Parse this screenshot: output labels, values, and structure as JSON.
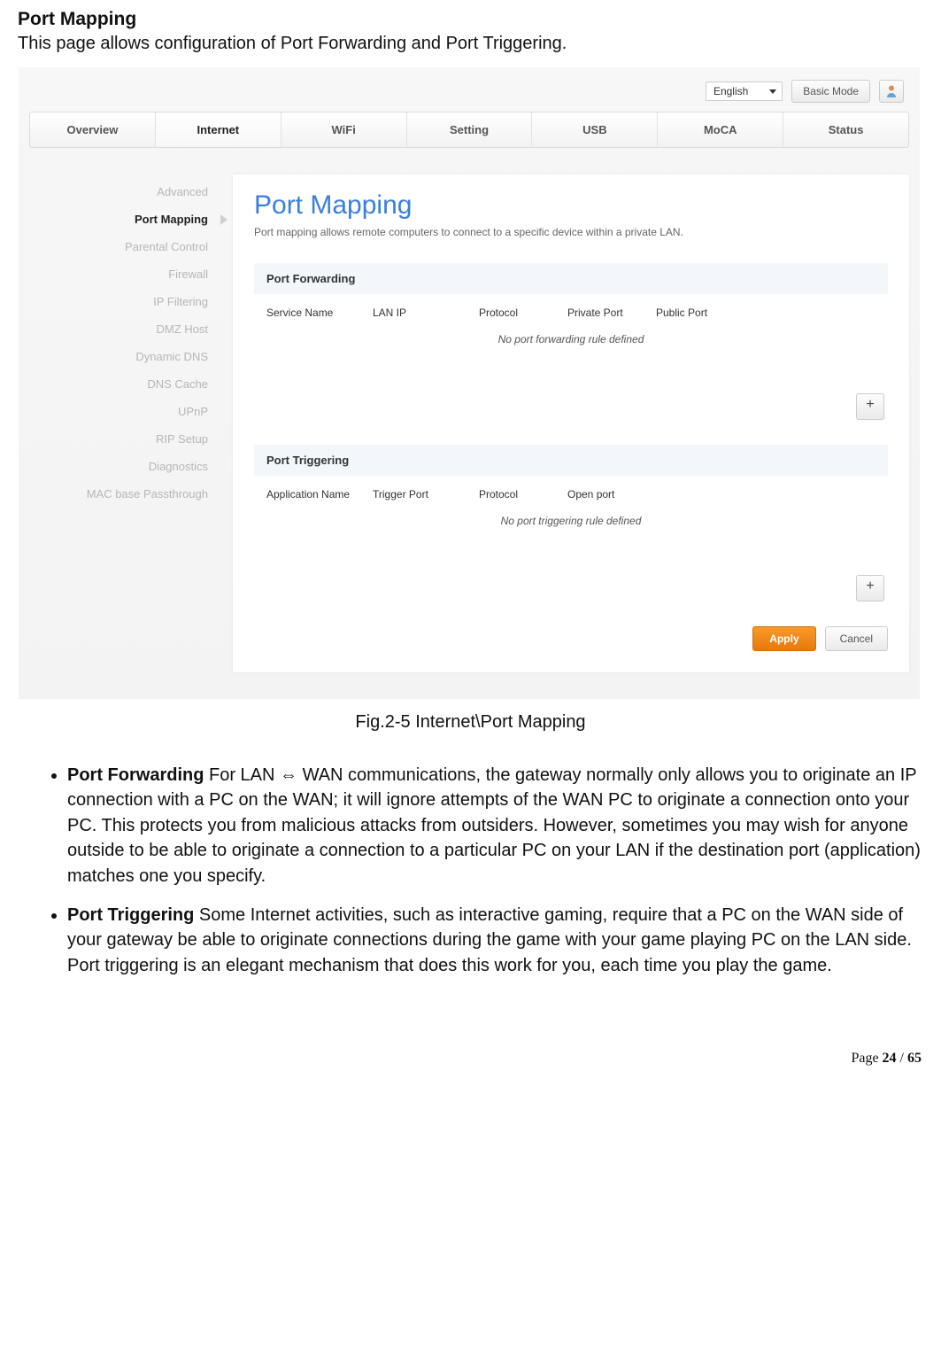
{
  "doc": {
    "title": "Port Mapping",
    "subtitle": "This page allows configuration of Port Forwarding and Port Triggering."
  },
  "topbar": {
    "language": "English",
    "basic_mode": "Basic Mode"
  },
  "nav": {
    "items": [
      "Overview",
      "Internet",
      "WiFi",
      "Setting",
      "USB",
      "MoCA",
      "Status"
    ],
    "active_index": 1
  },
  "sidebar": {
    "items": [
      "Advanced",
      "Port Mapping",
      "Parental Control",
      "Firewall",
      "IP Filtering",
      "DMZ Host",
      "Dynamic DNS",
      "DNS Cache",
      "UPnP",
      "RIP Setup",
      "Diagnostics",
      "MAC base Passthrough"
    ],
    "active_index": 1
  },
  "main": {
    "heading": "Port Mapping",
    "description": "Port mapping allows remote computers to connect to a specific device within a private LAN.",
    "port_forwarding": {
      "title": "Port Forwarding",
      "columns": [
        "Service Name",
        "LAN IP",
        "Protocol",
        "Private Port",
        "Public Port"
      ],
      "empty": "No port forwarding rule defined"
    },
    "port_triggering": {
      "title": "Port Triggering",
      "columns": [
        "Application Name",
        "Trigger Port",
        "Protocol",
        "Open port"
      ],
      "empty": "No port triggering rule defined"
    },
    "apply": "Apply",
    "cancel": "Cancel"
  },
  "figure_caption": "Fig.2-5 Internet\\Port Mapping",
  "bullets": [
    {
      "lead": "Port Forwarding ",
      "text": "For LAN ⇔ WAN communications, the gateway normally only allows you to originate an IP connection with a PC on the WAN; it will ignore attempts of the WAN PC to originate a connection onto your PC. This protects you from malicious attacks from outsiders. However, sometimes you may wish for anyone outside to be able to originate a connection to a particular PC on your LAN if the destination port (application) matches one you specify."
    },
    {
      "lead": "Port Triggering ",
      "text": "Some Internet activities, such as interactive gaming, require that a PC on the WAN side of your gateway be able to originate connections during the game with your game playing PC on the LAN side. Port triggering is an elegant mechanism that does this work for you, each time you play the game."
    }
  ],
  "footer": {
    "prefix": "Page ",
    "current": "24",
    "sep": " / ",
    "total": "65"
  }
}
